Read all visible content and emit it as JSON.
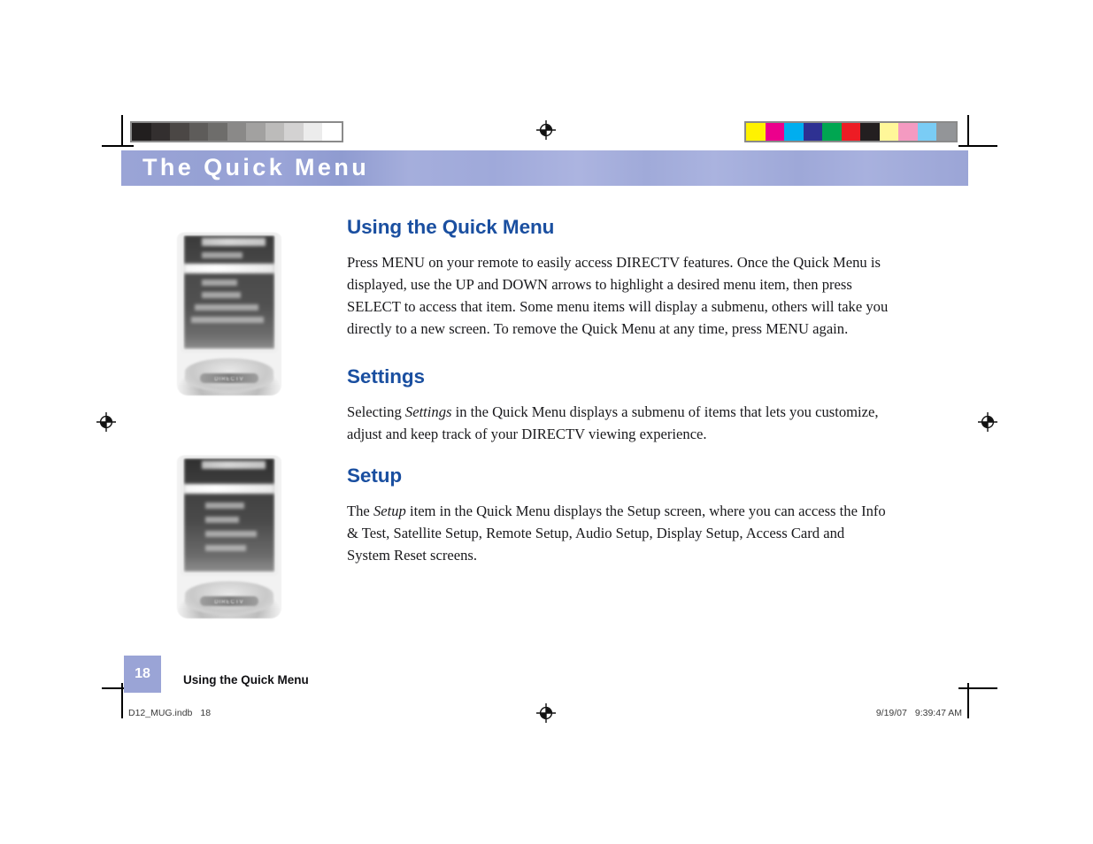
{
  "document": {
    "chapter_title": "The Quick Menu",
    "page_number": "18",
    "running_footer": "Using the Quick Menu"
  },
  "prepress": {
    "grayscale_swatches": [
      "#221f1f",
      "#332f2f",
      "#4b4745",
      "#5e5c5a",
      "#6e6d6b",
      "#8a8988",
      "#a2a1a0",
      "#bcbbba",
      "#d3d2d2",
      "#ececec",
      "#ffffff"
    ],
    "color_swatches": [
      "#fff200",
      "#ec008c",
      "#00aeef",
      "#2e3192",
      "#00a651",
      "#ed1c24",
      "#231f20",
      "#fff799",
      "#f49ac1",
      "#7accf5",
      "#939598"
    ],
    "registration_mark_name": "registration-target"
  },
  "sections": [
    {
      "id": "using-the-quick-menu",
      "heading": "Using the Quick Menu",
      "paragraphs": [
        "Press MENU on your remote to easily access DIRECTV features. Once the Quick Menu is displayed, use the UP and DOWN arrows to highlight a desired menu item, then press SELECT to access that item. Some menu items will display a submenu, others will take you directly to a new screen. To remove the Quick Menu at any time, press MENU again."
      ]
    },
    {
      "id": "settings",
      "heading": "Settings",
      "paragraph_lead": "Selecting ",
      "paragraph_italic": "Settings",
      "paragraph_rest": " in the Quick Menu displays a submenu of items that lets you customize, adjust and keep track of your DIRECTV viewing experience."
    },
    {
      "id": "setup",
      "heading": "Setup",
      "paragraph_lead": "The ",
      "paragraph_italic": "Setup",
      "paragraph_rest": " item in the Quick Menu displays the Setup screen, where you can access the Info & Test, Satellite Setup, Remote Setup, Audio Setup, Display Setup, Access Card and System Reset screens."
    }
  ],
  "figures": [
    {
      "id": "figure-quick-menu",
      "caption": "",
      "osd_title": "QUICK MENU",
      "badge_text": "DIRECTV"
    },
    {
      "id": "figure-quick-menu-settings",
      "caption": "",
      "osd_title": "QUICK MENU",
      "badge_text": "DIRECTV"
    }
  ],
  "slug": {
    "file_name": "D12_MUG.indb",
    "file_page": "18",
    "date": "9/19/07",
    "time": "9:39:47 AM"
  },
  "colors": {
    "heading_blue": "#1a4fa0",
    "band_periwinkle": "#9aa4d6",
    "folio_periwinkle": "#9aa4d6"
  }
}
